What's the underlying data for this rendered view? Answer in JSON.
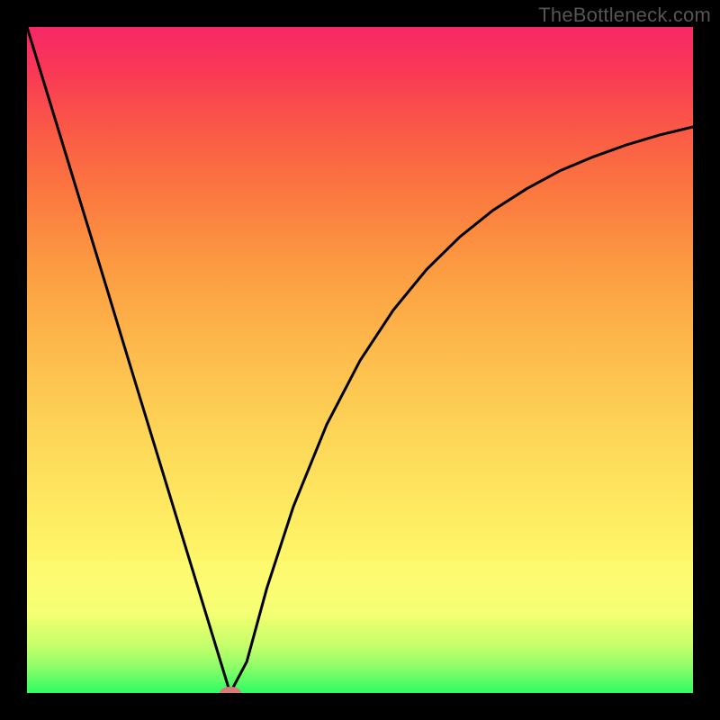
{
  "watermark": "TheBottleneck.com",
  "colors": {
    "frame": "#000000",
    "curve": "#000000",
    "marker": "#d97a7a"
  },
  "chart_data": {
    "type": "line",
    "title": "",
    "xlabel": "",
    "ylabel": "",
    "xlim": [
      0,
      100
    ],
    "ylim": [
      0,
      100
    ],
    "grid": false,
    "legend": false,
    "x": [
      0,
      4,
      8,
      12,
      16,
      20,
      24,
      28,
      30.5,
      33,
      36,
      40,
      45,
      50,
      55,
      60,
      65,
      70,
      75,
      80,
      85,
      90,
      95,
      100
    ],
    "values": [
      100,
      86.9,
      73.8,
      60.7,
      47.5,
      34.4,
      21.3,
      8.2,
      0,
      4.7,
      15.7,
      28.0,
      40.3,
      49.9,
      57.5,
      63.6,
      68.5,
      72.5,
      75.7,
      78.4,
      80.5,
      82.3,
      83.8,
      85.0
    ],
    "minimum": {
      "x": 30.5,
      "y": 0
    },
    "highlight_band_y": [
      11,
      20
    ],
    "marker": {
      "x": 30.5,
      "y": 0
    },
    "gradient_stops": [
      {
        "pct": 0,
        "color": "#2dfb63"
      },
      {
        "pct": 12,
        "color": "#f2fe6d"
      },
      {
        "pct": 40,
        "color": "#fdd356"
      },
      {
        "pct": 74,
        "color": "#fb7b3f"
      },
      {
        "pct": 100,
        "color": "#f82766"
      }
    ]
  }
}
